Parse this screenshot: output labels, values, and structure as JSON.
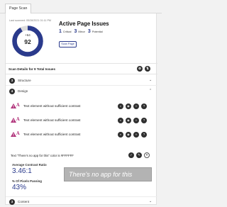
{
  "tabs": {
    "active": "Page Scan"
  },
  "summary": {
    "last_scanned": "Last scanned: 05/28/2021 01:11 PM",
    "delta": "+64",
    "score": "92",
    "title": "Active Page Issues",
    "counts": [
      {
        "value": "1",
        "label": "Critical"
      },
      {
        "value": "3",
        "label": "Minor"
      },
      {
        "value": "3",
        "label": "Potential"
      }
    ],
    "scan_button": "Scan Page",
    "score_fraction": 0.92,
    "colors": {
      "ring": "#2a3a8c",
      "ring_bg": "#dcdcdc",
      "accent": "#2a3a8c"
    }
  },
  "details": {
    "text": "Scan Details for 9 Total Issues",
    "icons": [
      "settings-icon",
      "sort-icon"
    ]
  },
  "sections": {
    "structure": {
      "badge": "3",
      "label": "Structure"
    },
    "design": {
      "badge": "4",
      "label": "Design"
    },
    "content": {
      "badge": "3",
      "label": "Content"
    }
  },
  "issues": [
    {
      "text": "Text element without sufficient contrast",
      "icons": [
        "zoom-icon",
        "eye-icon",
        "code-icon",
        "help-icon"
      ]
    },
    {
      "text": "Text element without sufficient contrast",
      "icons": [
        "zoom-icon",
        "eye-icon",
        "code-icon",
        "help-icon"
      ]
    },
    {
      "text": "Text element without sufficient contrast",
      "icons": [
        "zoom-icon",
        "eye-icon",
        "code-icon",
        "help-icon"
      ]
    }
  ],
  "expanded_issue": {
    "quote": "Text \"There's no app for this\" color is #FFFFFF",
    "ratio_label": "Average Contrast Ratio",
    "ratio_value": "3.46:1",
    "pixels_label": "% Of Pixels Passing",
    "pixels_value": "43%",
    "preview_text": "There's no app for this",
    "preview_bg": "#b3b3b3"
  }
}
